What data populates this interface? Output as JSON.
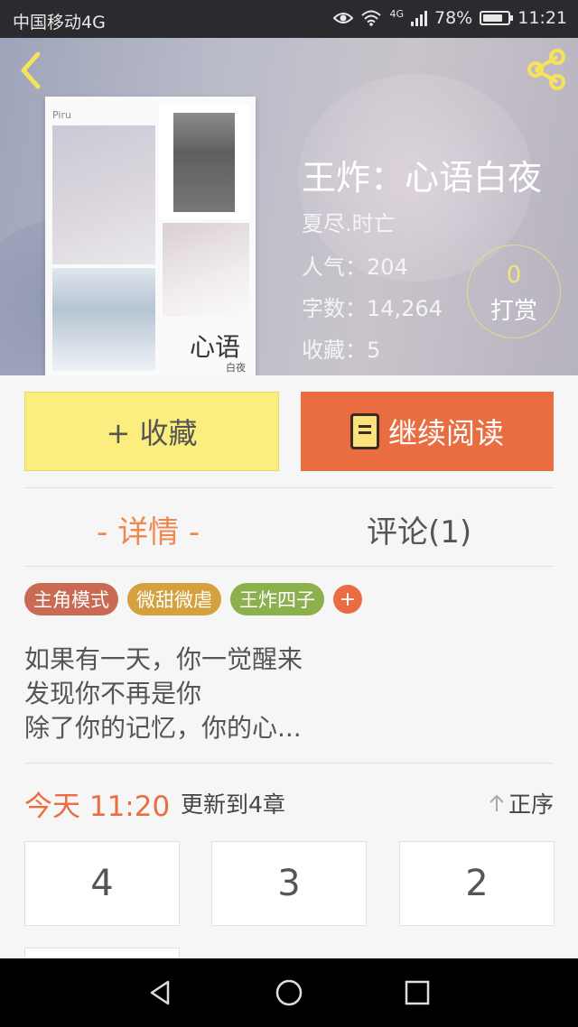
{
  "status_bar": {
    "carrier": "中国移动4G",
    "network": "4G",
    "battery_percent": "78%",
    "battery_level": 0.78,
    "time": "11:21"
  },
  "hero": {
    "back_icon": "chevron-left-icon",
    "share_icon": "share-icon",
    "cover_title": "心语",
    "cover_subtitle": "白夜",
    "cover_mark": "Piru",
    "title": "王炸：心语白夜",
    "author": "夏尽.时亡",
    "popularity": "人气：204",
    "word_count": "字数：14,264",
    "favorites": "收藏：5",
    "reward_count": "0",
    "reward_label": "打赏"
  },
  "actions": {
    "collect_label": "+ 收藏",
    "read_label": "继续阅读",
    "read_icon": "book-icon"
  },
  "tabs": [
    {
      "label": "- 详情 -",
      "active": true
    },
    {
      "label": "评论(1)",
      "active": false
    }
  ],
  "tags": [
    {
      "label": "主角模式",
      "color": "#c96a52"
    },
    {
      "label": "微甜微虐",
      "color": "#d4a13e"
    },
    {
      "label": "王炸四子",
      "color": "#8db04f"
    }
  ],
  "tag_add": "+",
  "description": [
    "如果有一天，你一觉醒来",
    "发现你不再是你",
    "除了你的记忆，你的心..."
  ],
  "update": {
    "time": "今天 11:20",
    "text": "更新到4章",
    "order_label": "正序",
    "order_icon": "arrow-up-icon"
  },
  "chapters": [
    "4",
    "3",
    "2"
  ],
  "colors": {
    "accent_orange": "#ea6c41",
    "collect_yellow": "#fbee7e",
    "tab_active": "#f0874c"
  },
  "nav_bar": {
    "back": "triangle-back-icon",
    "home": "circle-home-icon",
    "recents": "square-recents-icon"
  }
}
